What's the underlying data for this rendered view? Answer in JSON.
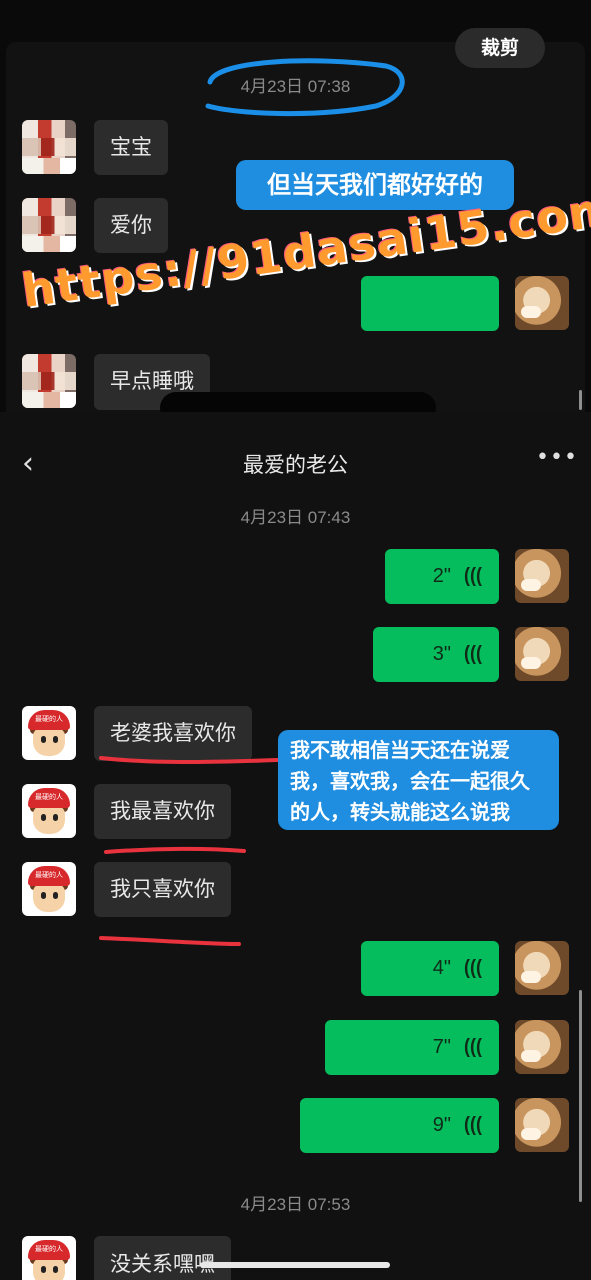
{
  "top_panel": {
    "crop_button": "裁剪",
    "timestamp": "4月23日 07:38",
    "messages": [
      {
        "text": "宝宝"
      },
      {
        "text": "爱你"
      },
      {
        "text": "早点睡哦"
      }
    ],
    "annotation": "但当天我们都好好的",
    "watermark": "https://91dasai15.com"
  },
  "chat": {
    "title": "最爱的老公",
    "back_icon": "chevron-left-icon",
    "more_icon": "ellipsis-icon",
    "timestamp_1": "4月23日 07:43",
    "voice_1": "2\"",
    "voice_2": "3\"",
    "messages": [
      {
        "text": "老婆我喜欢你"
      },
      {
        "text": "我最喜欢你"
      },
      {
        "text": "我只喜欢你"
      }
    ],
    "annotation": "我不敢相信当天还在说爱我，喜欢我，会在一起很久的人，转头就能这么说我",
    "voice_3": "4\"",
    "voice_4": "7\"",
    "voice_5": "9\"",
    "timestamp_2": "4月23日 07:53",
    "last_message": "没关系嘿嘿"
  },
  "colors": {
    "outgoing_bubble": "#06bd5d",
    "incoming_bubble": "#2c2c2c",
    "annotation_blue": "#1f8de0",
    "circle_mark": "#1b8fe8",
    "underline_mark": "#e8333f"
  },
  "avatar_badge": "最硬的人"
}
